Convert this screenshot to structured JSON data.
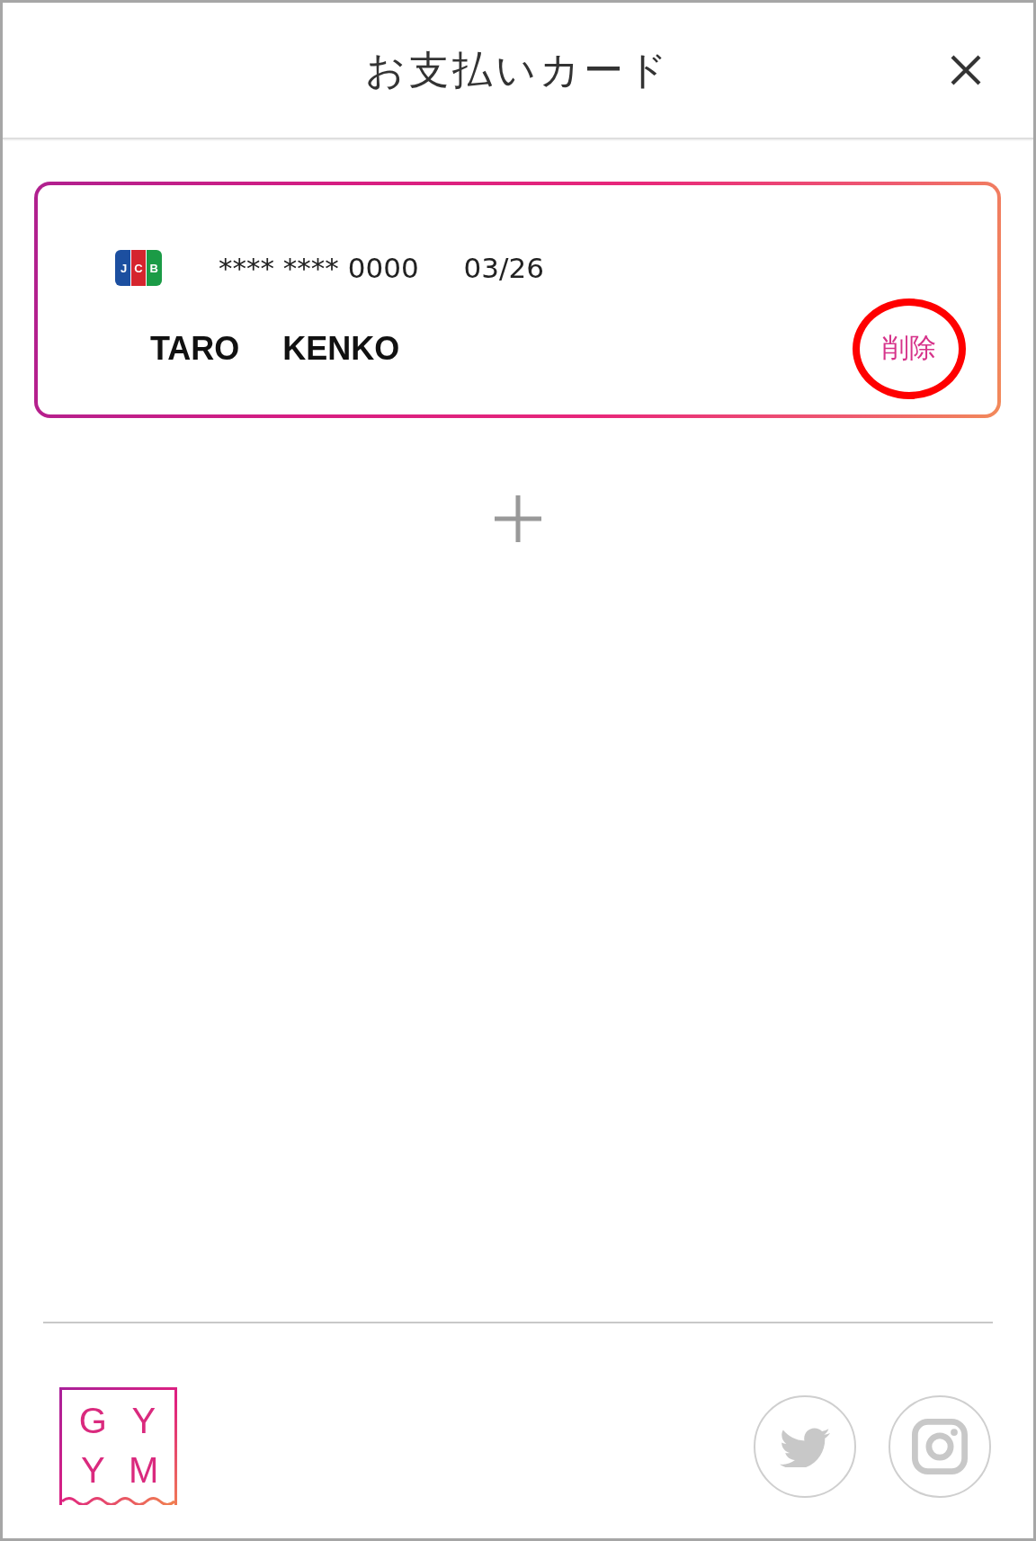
{
  "header": {
    "title": "お支払いカード"
  },
  "cards": [
    {
      "brand": "JCB",
      "number": "**** **** 0000",
      "expiry": "03/26",
      "holder": [
        "TARO",
        "KENKO"
      ],
      "delete": {
        "label": "削除",
        "highlighted": true
      }
    }
  ],
  "footer": {
    "logo": {
      "letters": [
        "G",
        "Y",
        "Y",
        "M"
      ]
    }
  }
}
